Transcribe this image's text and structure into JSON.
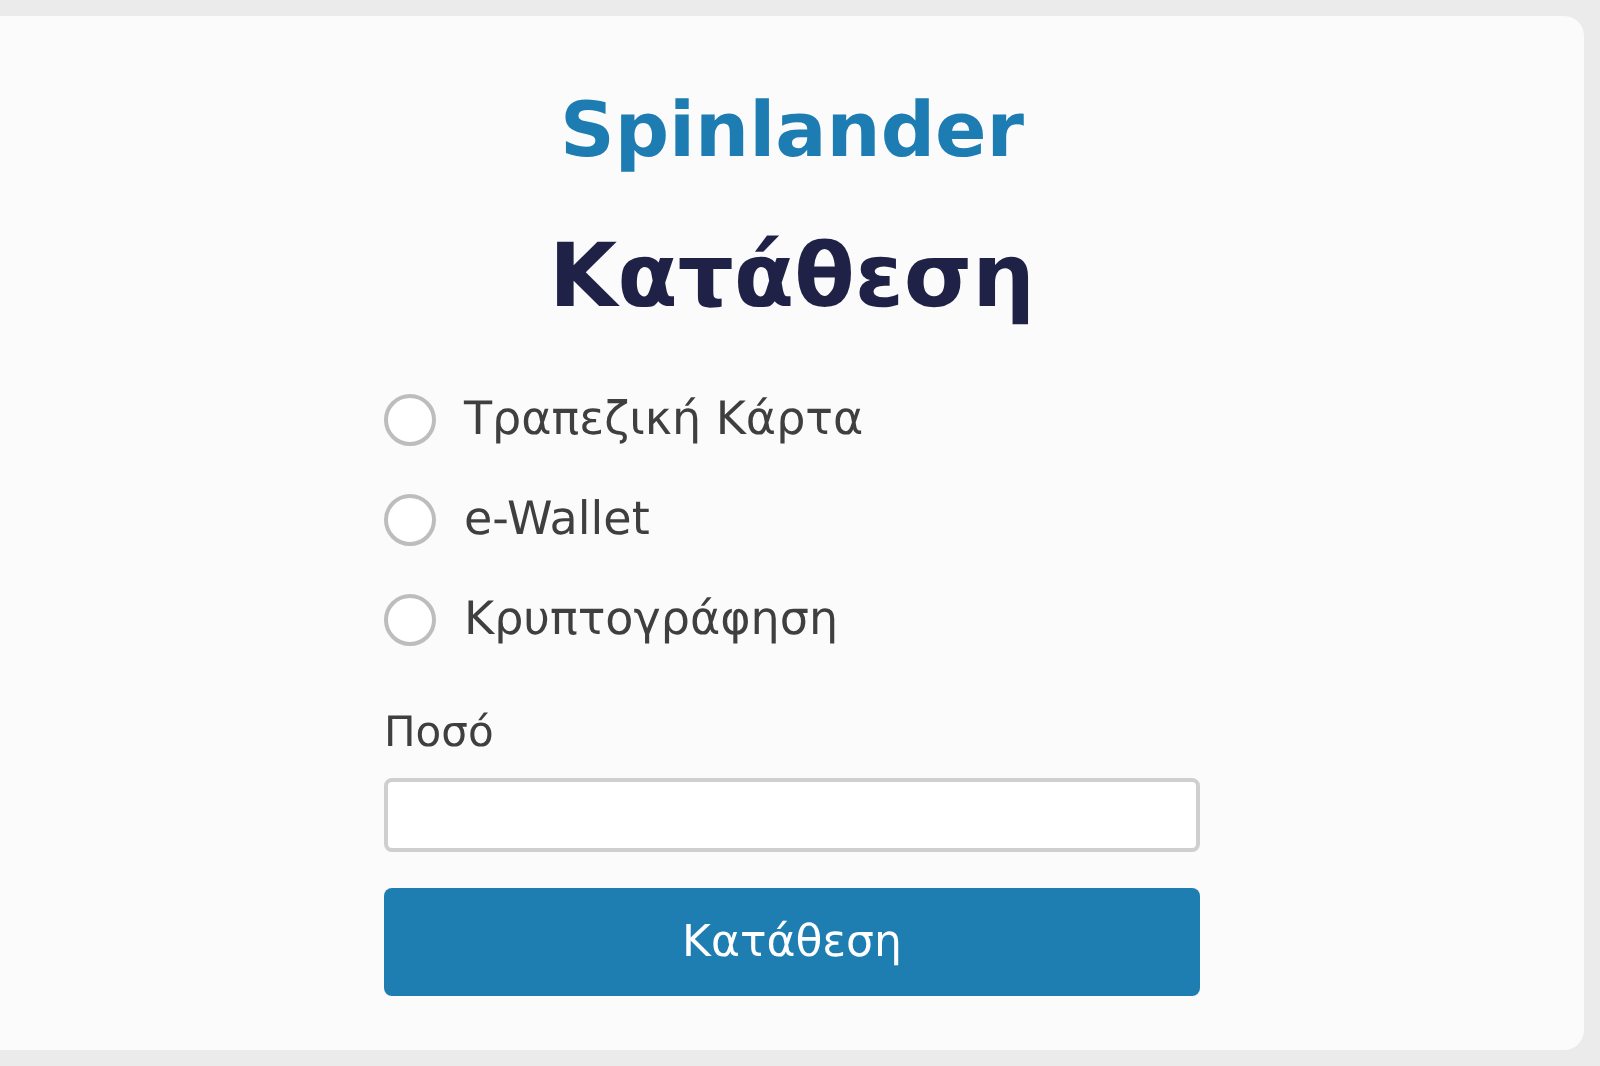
{
  "brand": "Spinlander",
  "heading": "Κατάθεση",
  "payment_methods": [
    {
      "label": "Τραπεζική Κάρτα",
      "selected": false
    },
    {
      "label": "e-Wallet",
      "selected": false
    },
    {
      "label": "Κρυπτογράφηση",
      "selected": false
    }
  ],
  "amount": {
    "label": "Ποσό"
  },
  "submit_button": "Κατάθεση"
}
